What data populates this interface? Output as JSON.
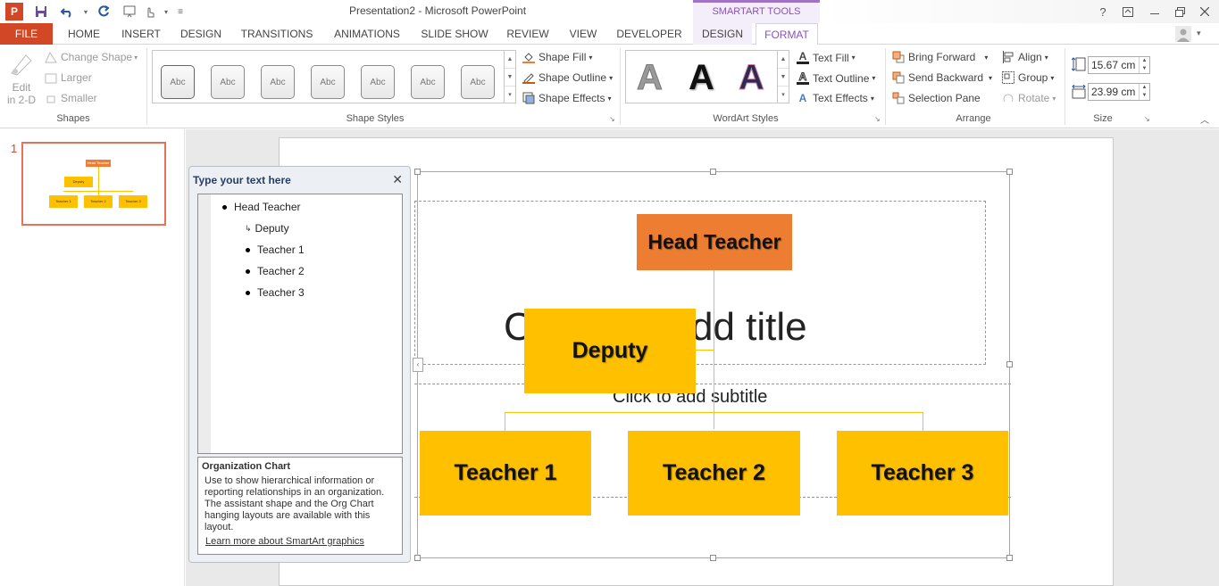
{
  "window": {
    "title": "Presentation2 - Microsoft PowerPoint",
    "context_group": "SMARTART TOOLS",
    "help": "?",
    "app_logo_letter": "P"
  },
  "tabs": [
    "FILE",
    "HOME",
    "INSERT",
    "DESIGN",
    "TRANSITIONS",
    "ANIMATIONS",
    "SLIDE SHOW",
    "REVIEW",
    "VIEW",
    "DEVELOPER",
    "DESIGN",
    "FORMAT"
  ],
  "ribbon": {
    "shapes": {
      "edit_2d_line1": "Edit",
      "edit_2d_line2": "in 2-D",
      "change_shape": "Change Shape",
      "larger": "Larger",
      "smaller": "Smaller",
      "label": "Shapes"
    },
    "shape_styles": {
      "thumb": "Abc",
      "fill": "Shape Fill",
      "outline": "Shape Outline",
      "effects": "Shape Effects",
      "label": "Shape Styles"
    },
    "wordart": {
      "glyph": "A",
      "text_fill": "Text Fill",
      "text_outline": "Text Outline",
      "text_effects": "Text Effects",
      "label": "WordArt Styles"
    },
    "arrange": {
      "bring_forward": "Bring Forward",
      "send_backward": "Send Backward",
      "selection_pane": "Selection Pane",
      "align": "Align",
      "group": "Group",
      "rotate": "Rotate",
      "label": "Arrange"
    },
    "size": {
      "height": "15.67 cm",
      "width": "23.99 cm",
      "label": "Size"
    }
  },
  "thumbnails": {
    "slide_number": "1",
    "mini_head": "Head Teacher",
    "mini_deputy": "Deputy",
    "mini_t1": "Teacher 1",
    "mini_t2": "Teacher 2",
    "mini_t3": "Teacher 3"
  },
  "text_pane": {
    "title": "Type your text here",
    "items": [
      "Head Teacher",
      "Deputy",
      "Teacher 1",
      "Teacher 2",
      "Teacher 3"
    ],
    "desc_title": "Organization Chart",
    "desc_body": "Use to show hierarchical information or reporting relationships in an organization. The assistant shape and the Org Chart hanging layouts are available with this layout.",
    "learn_more": "Learn more about SmartArt graphics"
  },
  "slide": {
    "title_placeholder_visible_left": "C",
    "title_placeholder_visible_right": "dd title",
    "subtitle_placeholder": "Click to add subtitle"
  },
  "org_chart": {
    "head": "Head Teacher",
    "assistant": "Deputy",
    "reports": [
      "Teacher 1",
      "Teacher 2",
      "Teacher 3"
    ]
  },
  "colors": {
    "file_tab": "#d24726",
    "head_box": "#ed7d31",
    "box": "#ffc000",
    "context_accent": "#a074c4",
    "thumb_border": "#e8715a"
  }
}
